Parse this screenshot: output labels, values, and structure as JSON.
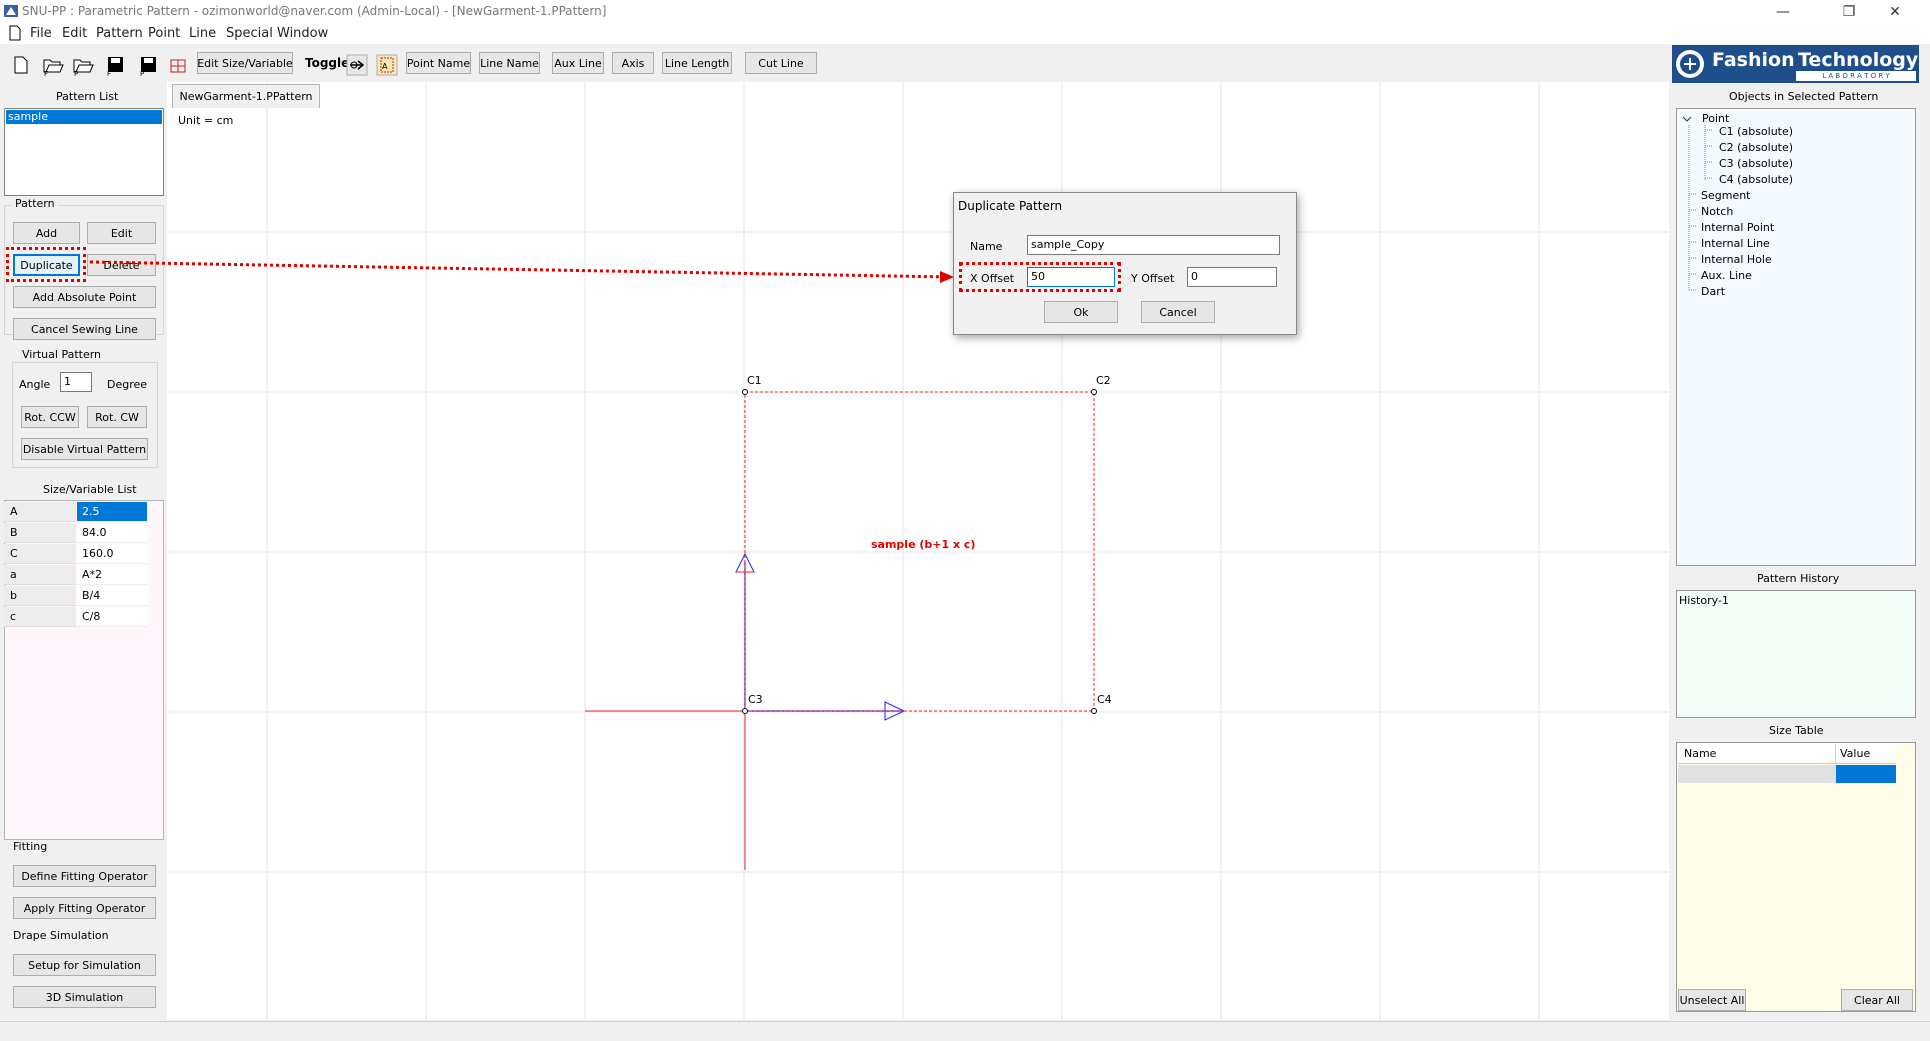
{
  "window": {
    "title": "SNU-PP : Parametric Pattern  - ozimonworld@naver.com (Admin-Local) - [NewGarment-1.PPattern]"
  },
  "menu": [
    "File",
    "Edit",
    "Pattern",
    "Point",
    "Line",
    "Special",
    "Window"
  ],
  "toolbar": {
    "edit_size": "Edit Size/Variable",
    "toggle": "Toggle",
    "point_name": "Point Name",
    "line_name": "Line Name",
    "aux_line": "Aux Line",
    "axis": "Axis",
    "line_length": "Line Length",
    "cut_line": "Cut Line"
  },
  "logo": {
    "word1": "Fashion",
    "word2": "Technology",
    "sub": "L A B O R A T O R Y"
  },
  "left": {
    "pattern_list_title": "Pattern List",
    "patterns": [
      "sample"
    ],
    "pattern_group": "Pattern",
    "add": "Add",
    "edit": "Edit",
    "duplicate": "Duplicate",
    "delete": "Delete",
    "add_absolute_point": "Add Absolute Point",
    "cancel_sewing_line": "Cancel Sewing Line",
    "virtual_pattern": "Virtual Pattern",
    "angle_label": "Angle",
    "angle_value": "1",
    "degree_label": "Degree",
    "rot_ccw": "Rot. CCW",
    "rot_cw": "Rot. CW",
    "disable_virtual": "Disable Virtual Pattern",
    "size_var_title": "Size/Variable List",
    "size_vars": [
      {
        "name": "A",
        "value": "2.5"
      },
      {
        "name": "B",
        "value": "84.0"
      },
      {
        "name": "C",
        "value": "160.0"
      },
      {
        "name": "a",
        "value": "A*2"
      },
      {
        "name": "b",
        "value": "B/4"
      },
      {
        "name": "c",
        "value": "C/8"
      }
    ],
    "fitting": "Fitting",
    "define_fitting": "Define Fitting Operator",
    "apply_fitting": "Apply Fitting Operator",
    "drape_sim": "Drape Simulation",
    "setup_sim": "Setup for Simulation",
    "sim_3d": "3D Simulation"
  },
  "canvas": {
    "tab": "NewGarment-1.PPattern",
    "unit": "Unit = cm",
    "pattern_label": "sample (b+1 x c)",
    "points": [
      "C1",
      "C2",
      "C3",
      "C4"
    ]
  },
  "dialog": {
    "title": "Duplicate Pattern",
    "name_label": "Name",
    "name_value": "sample_Copy",
    "x_label": "X Offset",
    "x_value": "50",
    "y_label": "Y Offset",
    "y_value": "0",
    "ok": "Ok",
    "cancel": "Cancel"
  },
  "right": {
    "objects_title": "Objects in Selected Pattern",
    "tree_root": "Point",
    "tree_points": [
      "C1 (absolute)",
      "C2 (absolute)",
      "C3 (absolute)",
      "C4 (absolute)"
    ],
    "tree_items": [
      "Segment",
      "Notch",
      "Internal Point",
      "Internal Line",
      "Internal Hole",
      "Aux. Line",
      "Dart"
    ],
    "history_title": "Pattern History",
    "history": [
      "History-1"
    ],
    "size_table_title": "Size Table",
    "size_table_cols": [
      "Name",
      "Value"
    ],
    "unselect_all": "Unselect All",
    "clear_all": "Clear All"
  },
  "colors": {
    "accent_blue": "#0078d7",
    "annotation_red": "#e00000",
    "logo_blue": "#1f4e8c"
  }
}
